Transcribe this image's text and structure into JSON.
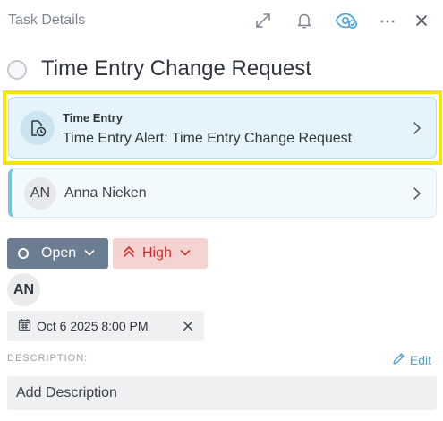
{
  "header": {
    "title": "Task Details",
    "icons": [
      "expand-icon",
      "bell-icon",
      "watch-icon",
      "more-icon",
      "close-icon"
    ]
  },
  "task": {
    "title": "Time Entry Change Request"
  },
  "related_card": {
    "label": "Time Entry",
    "description": "Time Entry Alert: Time Entry Change Request"
  },
  "contact": {
    "initials": "AN",
    "name": "Anna Nieken"
  },
  "status": {
    "label": "Open"
  },
  "priority": {
    "label": "High"
  },
  "assignee": {
    "initials": "AN"
  },
  "due_date": {
    "value": "Oct 6 2025 8:00 PM"
  },
  "description": {
    "label": "DESCRIPTION:",
    "edit_label": "Edit",
    "placeholder": "Add Description"
  },
  "colors": {
    "highlight": "#f5e600",
    "status_bg": "#6c7d91",
    "priority_bg": "#f4d3d1",
    "priority_fg": "#d32f2f",
    "link": "#4f9fd1"
  }
}
